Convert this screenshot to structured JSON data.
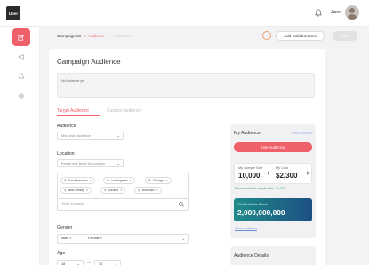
{
  "app": {
    "logo": "Uber"
  },
  "header": {
    "user_name": "Jane",
    "bell_icon": "bell-icon",
    "avatar_icon": "avatar"
  },
  "sidebar": {
    "items": [
      {
        "icon": "edit-icon",
        "active": true
      },
      {
        "icon": "megaphone-icon",
        "active": false
      },
      {
        "icon": "bell-icon",
        "active": false
      },
      {
        "icon": "gear-icon",
        "active": false
      }
    ]
  },
  "breadcrumb": [
    {
      "label": "Campaign 01"
    },
    {
      "label": "> Audience"
    },
    {
      "label": "> Content"
    }
  ],
  "toolbar": {
    "collab_label": "Add Collaborators",
    "next_label": "Next"
  },
  "page": {
    "title": "Campaign Audience"
  },
  "description": {
    "value": "No Audience yet"
  },
  "tabs": [
    {
      "label": "Target Audience",
      "active": true
    },
    {
      "label": "Custom Audience",
      "active": false
    }
  ],
  "audience": {
    "label": "Audience",
    "select_value": "Most Used Audience"
  },
  "location": {
    "label": "Location",
    "filter_value": "People who live in this location",
    "chips": [
      "San Francisco",
      "Los Angeles",
      "Chicago",
      "New Jersey",
      "Toronto",
      "Honolulu"
    ],
    "input_placeholder": "Enter a location"
  },
  "gender": {
    "label": "Gender",
    "chips": [
      "Male",
      "Female"
    ]
  },
  "age": {
    "label": "Age",
    "from": "18",
    "to": "30",
    "separator": "—"
  },
  "my_audience": {
    "title": "My Audience",
    "save_label": "Save Audience",
    "use_label": "Use Audience",
    "sample_size_label": "My Sample Size",
    "sample_size_value": "10,000",
    "cost_label": "My Cost",
    "cost_value": "$2,300",
    "recommended": "Recommended sample size : 20,000",
    "reach_label": "Total Available Reach",
    "reach_value": "2,000,000,000",
    "about_label": "About audience"
  },
  "audience_details": {
    "title": "Audience Details"
  },
  "colors": {
    "accent": "#f0606a",
    "reach_start": "#1f8b8a",
    "reach_end": "#1d4f83"
  }
}
